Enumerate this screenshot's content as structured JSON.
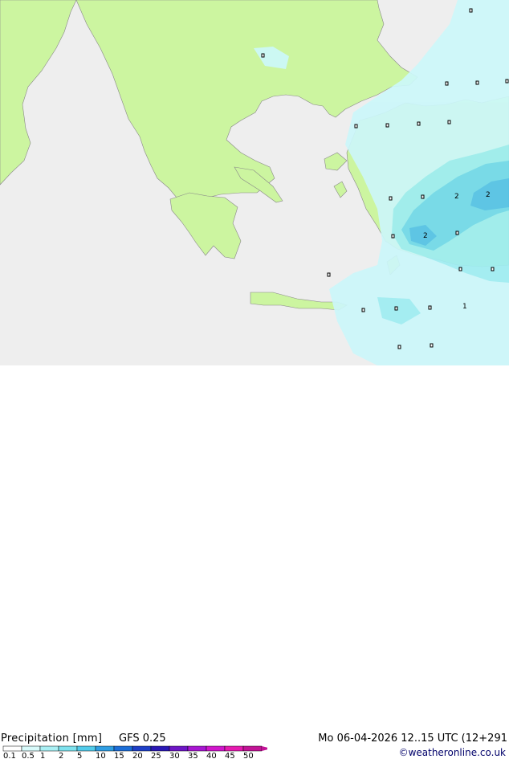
{
  "title": "Precipitation [mm]",
  "model": "GFS 0.25",
  "datetime": "Mo 06-04-2026 12..15 UTC (12+291",
  "credit": "©weatheronline.co.uk",
  "colors": {
    "sea": "#eeeeee",
    "land": "#ccf5a0",
    "light_precip": "#ccf7fa",
    "medium_precip": "#9eedf2",
    "heavy_precip": "#72d8ee",
    "heavier_precip": "#55c2ea"
  },
  "legend": {
    "ticks": [
      "0.1",
      "0.5",
      "1",
      "2",
      "5",
      "10",
      "15",
      "20",
      "25",
      "30",
      "35",
      "40",
      "45",
      "50"
    ],
    "colors": [
      "#ffffff",
      "#d8fafa",
      "#aaf0f4",
      "#7ee2ee",
      "#52cceb",
      "#2f9ee3",
      "#1c6ed8",
      "#1e3fc7",
      "#2a18b5",
      "#6e16c6",
      "#a816d2",
      "#d116cc",
      "#e61ab0",
      "#c21396"
    ]
  },
  "precip_values": [
    {
      "label": "2",
      "name": "value-label-1"
    },
    {
      "label": "2",
      "name": "value-label-2"
    },
    {
      "label": "2",
      "name": "value-label-3"
    },
    {
      "label": "1",
      "name": "value-label-4"
    }
  ]
}
